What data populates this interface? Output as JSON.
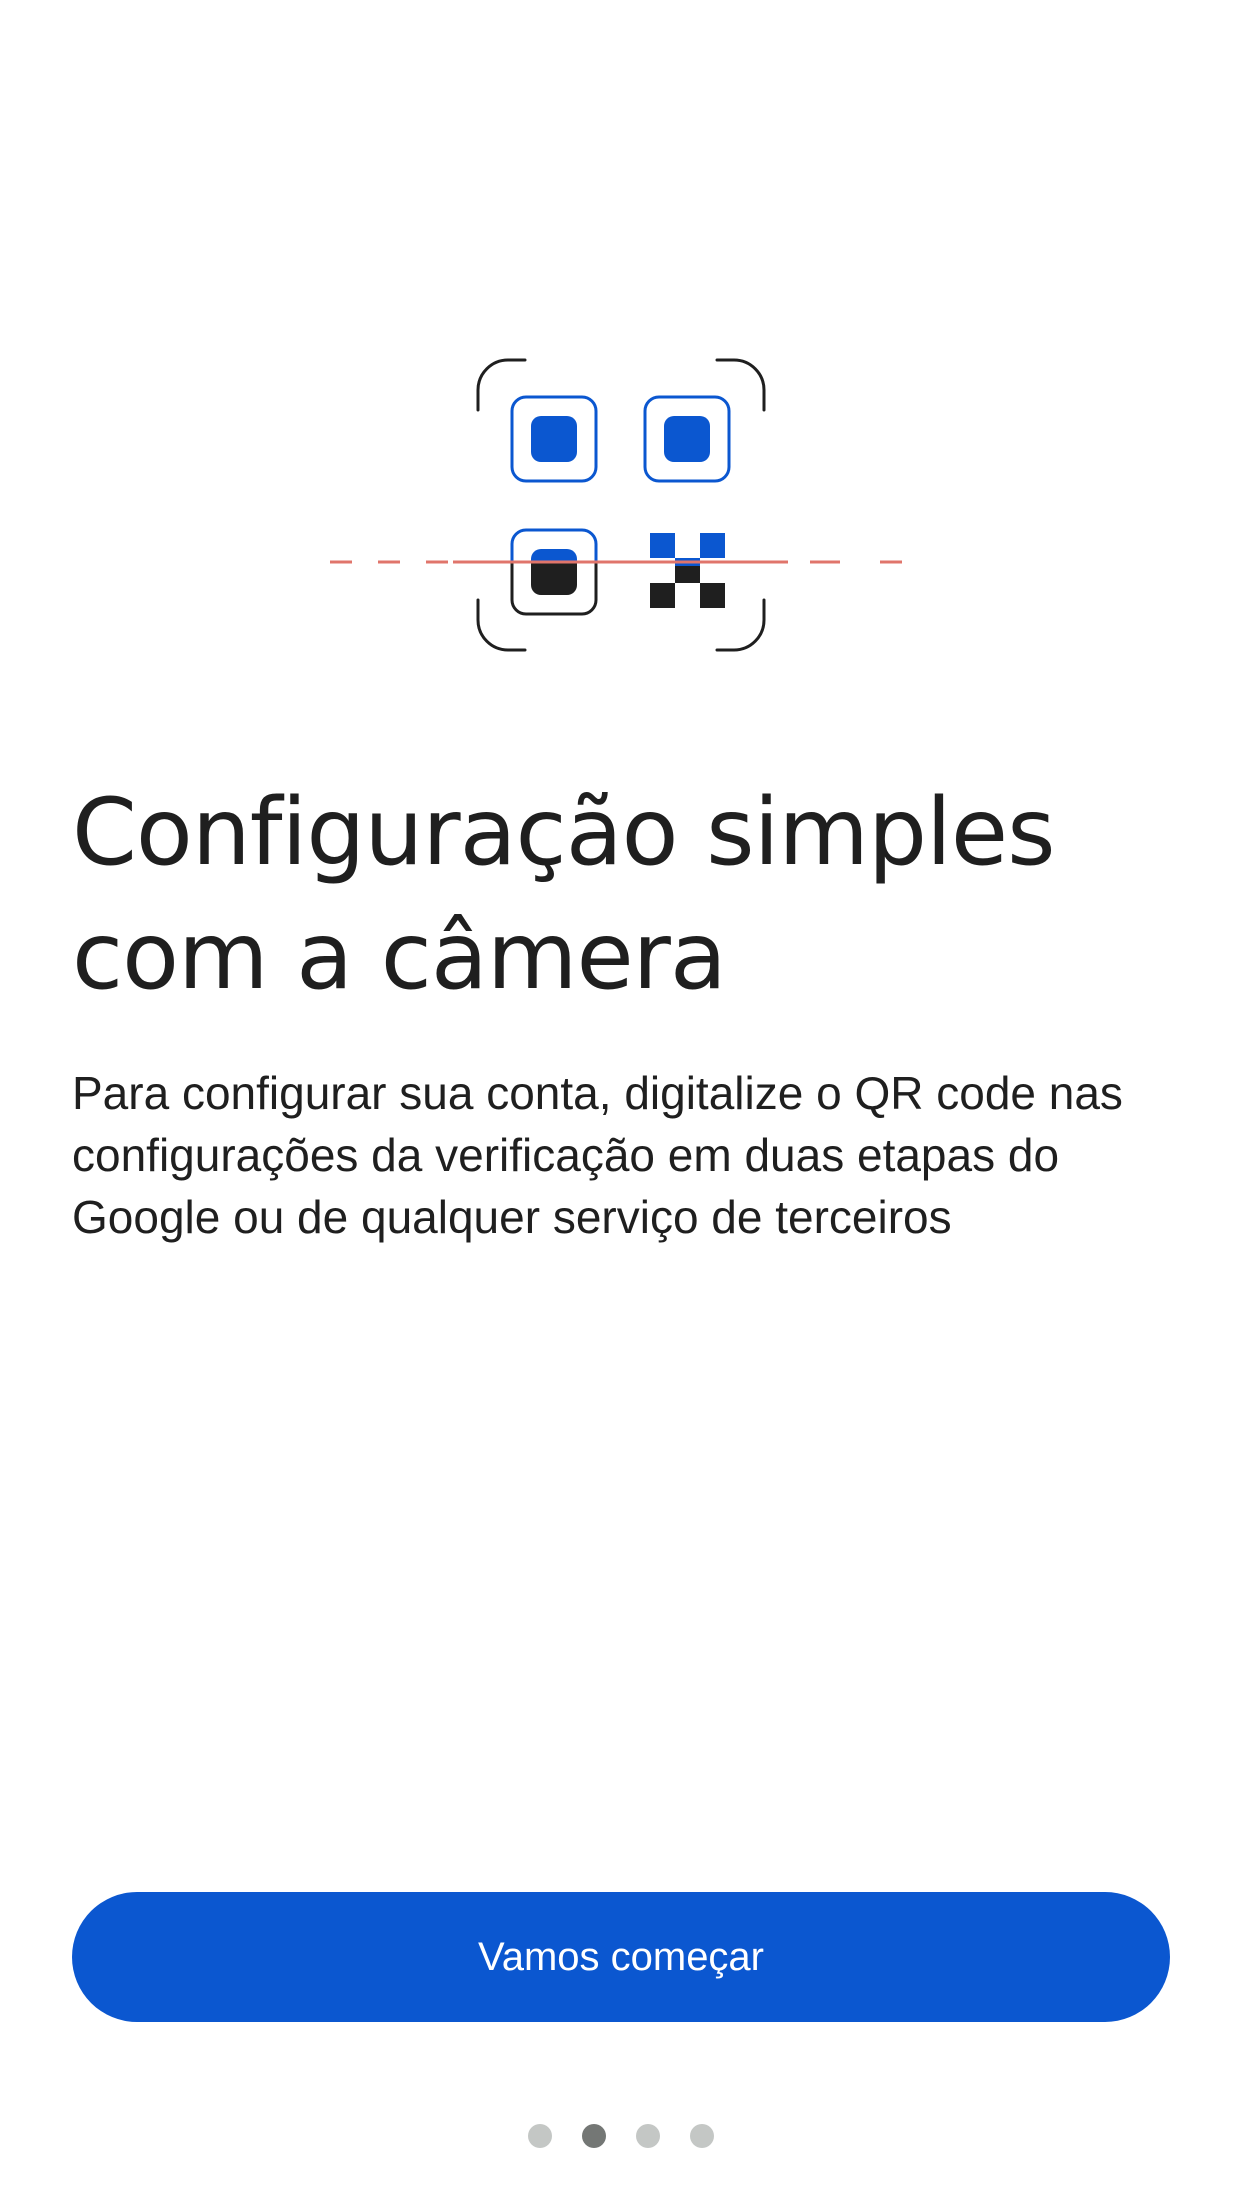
{
  "illustration": {
    "icon": "qr-code-scan-icon",
    "colors": {
      "primary": "#0b57d0",
      "dark": "#1f1f1f",
      "scan_line": "#e0756b"
    }
  },
  "content": {
    "title": "Configuração simples com a câmera",
    "description": "Para configurar sua conta, digitalize o QR code nas configurações da verificação em duas etapas do Google ou de qualquer serviço de terceiros"
  },
  "actions": {
    "primary_label": "Vamos começar",
    "primary_color": "#0b57d0"
  },
  "pager": {
    "total": 4,
    "current": 2
  }
}
